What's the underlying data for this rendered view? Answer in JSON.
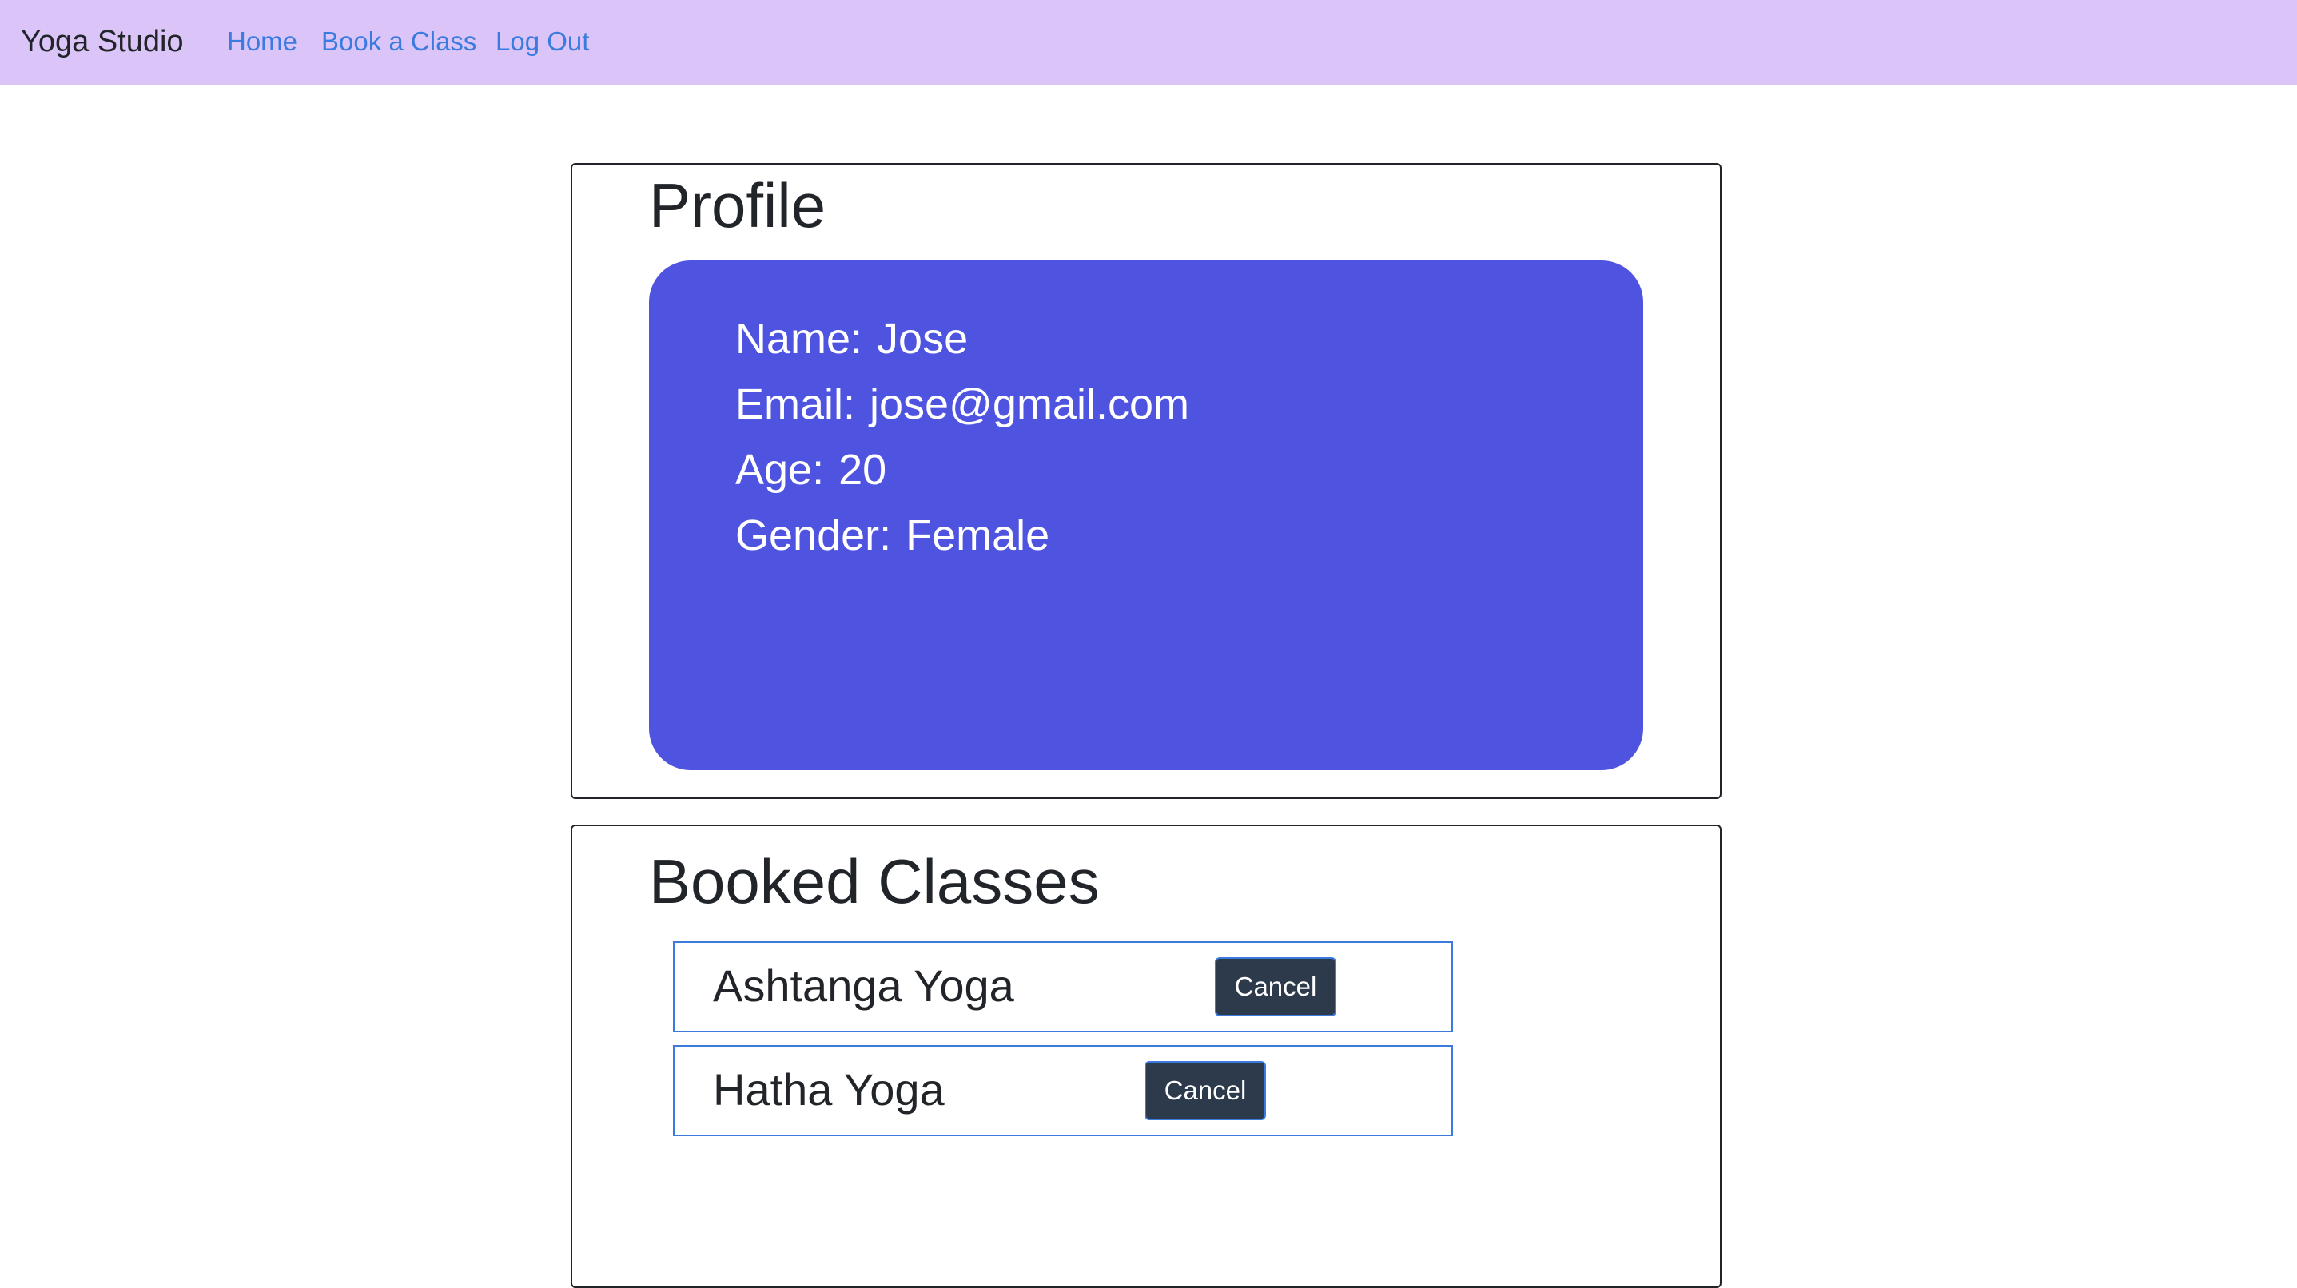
{
  "navbar": {
    "brand": "Yoga Studio",
    "links": [
      {
        "label": "Home"
      },
      {
        "label": "Book a Class"
      },
      {
        "label": "Log Out"
      }
    ],
    "background": "#dbc5f8",
    "link_color": "#3b7be0"
  },
  "profile": {
    "title": "Profile",
    "card_color": "#4f54e0",
    "fields": [
      {
        "label": "Name:",
        "value": "Jose"
      },
      {
        "label": "Email:",
        "value": "jose@gmail.com"
      },
      {
        "label": "Age:",
        "value": "20"
      },
      {
        "label": "Gender:",
        "value": "Female"
      }
    ]
  },
  "booked": {
    "title": "Booked Classes",
    "classes": [
      {
        "name": "Ashtanga Yoga",
        "button": "Cancel"
      },
      {
        "name": "Hatha Yoga",
        "button": "Cancel"
      }
    ]
  }
}
